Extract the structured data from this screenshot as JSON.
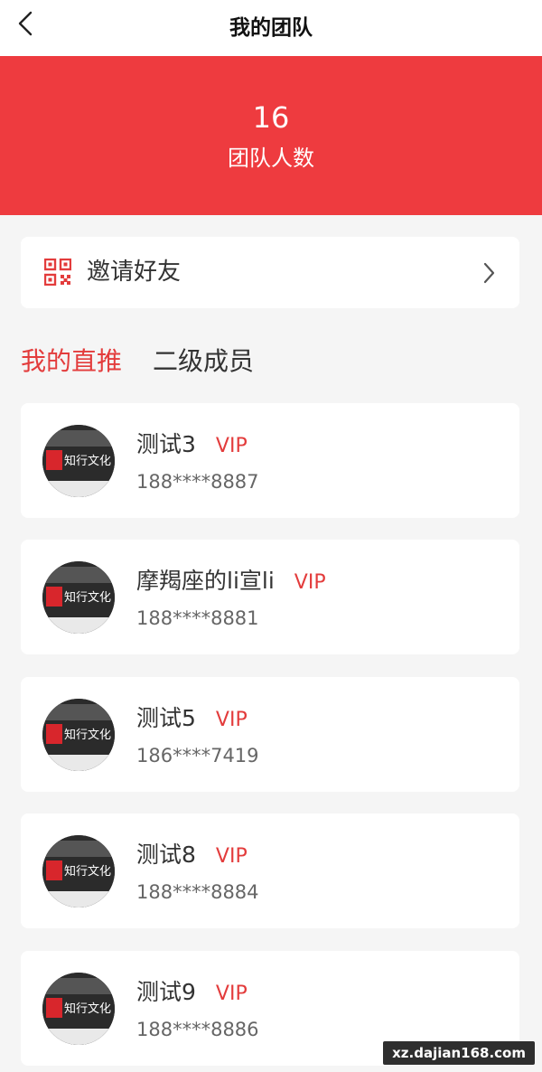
{
  "header": {
    "title": "我的团队"
  },
  "banner": {
    "count": "16",
    "label": "团队人数"
  },
  "invite": {
    "label": "邀请好友"
  },
  "tabs": [
    {
      "label": "我的直推",
      "active": true
    },
    {
      "label": "二级成员",
      "active": false
    }
  ],
  "members": [
    {
      "name": "测试3",
      "badge": "VIP",
      "phone": "188****8887"
    },
    {
      "name": "摩羯座的li宣li",
      "badge": "VIP",
      "phone": "188****8881"
    },
    {
      "name": "测试5",
      "badge": "VIP",
      "phone": "186****7419"
    },
    {
      "name": "测试8",
      "badge": "VIP",
      "phone": "188****8884"
    },
    {
      "name": "测试9",
      "badge": "VIP",
      "phone": "188****8886"
    }
  ],
  "avatar": {
    "logo_text": "知行文化"
  },
  "watermark": "xz.dajian168.com",
  "colors": {
    "accent": "#ee3b3f",
    "text": "#333333",
    "background": "#f5f5f5"
  },
  "icons": {
    "back": "chevron-left-icon",
    "qr": "qr-code-icon",
    "arrow": "chevron-right-icon"
  }
}
